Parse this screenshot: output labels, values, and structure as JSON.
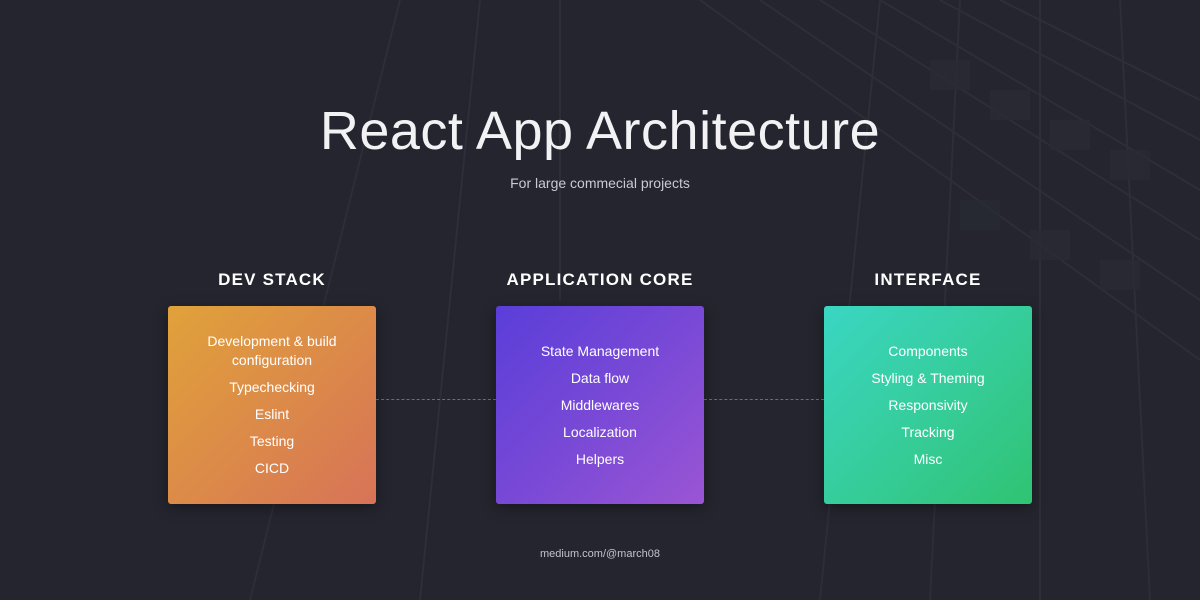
{
  "title": "React App Architecture",
  "subtitle": "For large commecial projects",
  "columns": [
    {
      "heading": "DEV STACK",
      "items": [
        "Development & build configuration",
        "Typechecking",
        "Eslint",
        "Testing",
        "CICD"
      ]
    },
    {
      "heading": "APPLICATION CORE",
      "items": [
        "State Management",
        "Data flow",
        "Middlewares",
        "Localization",
        "Helpers"
      ]
    },
    {
      "heading": "INTERFACE",
      "items": [
        "Components",
        "Styling & Theming",
        "Responsivity",
        "Tracking",
        "Misc"
      ]
    }
  ],
  "footer": "medium.com/@march08",
  "colors": {
    "background": "#24252e",
    "dev_stack_gradient": [
      "#e0a23a",
      "#d77358"
    ],
    "application_core_gradient": [
      "#5a3ed9",
      "#9b55d4"
    ],
    "interface_gradient": [
      "#3ad6c3",
      "#2fc372"
    ],
    "connector": "#6a6c78"
  }
}
